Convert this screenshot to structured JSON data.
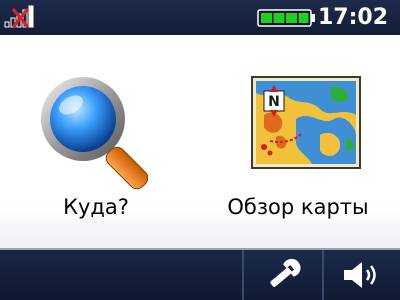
{
  "status": {
    "clock": "17:02",
    "gps_icon": "no-gps-signal-icon",
    "battery_icon": "battery-full-icon",
    "battery_level": 1.0,
    "battery_color": "#1fd01f"
  },
  "menu": {
    "where_to": {
      "label": "Куда?",
      "icon": "magnifying-glass-icon"
    },
    "view_map": {
      "label": "Обзор карты",
      "icon": "map-icon"
    }
  },
  "toolbar": {
    "settings_icon": "wrench-icon",
    "volume_icon": "speaker-icon"
  },
  "colors": {
    "status_bar": "#17233f",
    "main_bg": "#ffffff",
    "toolbar": "#12203b",
    "accent_red": "#e02020"
  }
}
